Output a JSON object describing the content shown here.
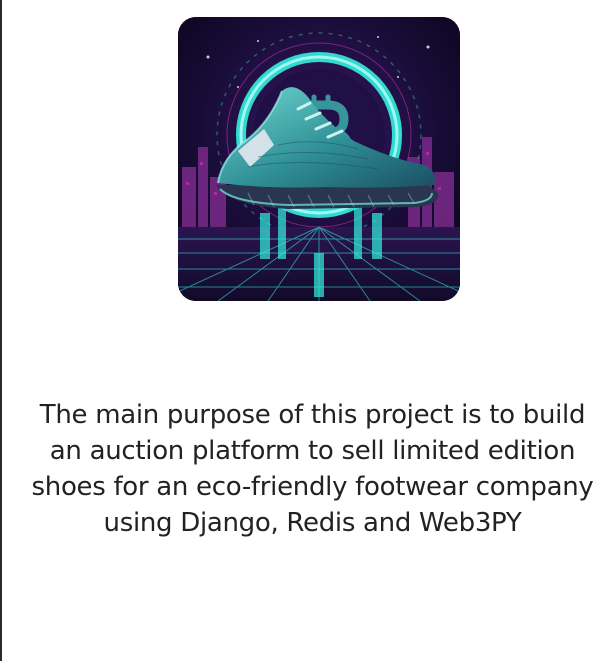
{
  "hero": {
    "image_icon": "sneaker-bitcoin-logo-illustration",
    "colors": {
      "background": "#120a2a",
      "neon_cyan": "#34f0e0",
      "neon_magenta": "#d238c8",
      "shoe_teal": "#3aa6a6"
    }
  },
  "description": {
    "text": "The main purpose of this project is to build an auction platform to sell limited edition shoes for an eco-friendly footwear company using Django, Redis and Web3PY"
  }
}
